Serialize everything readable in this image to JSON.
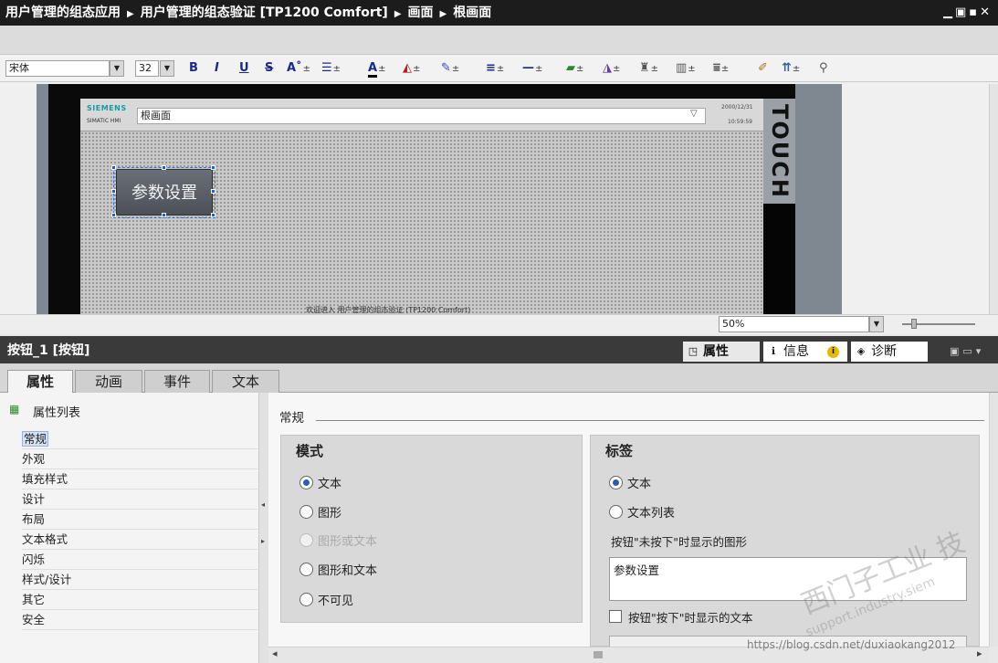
{
  "titlebar": {
    "crumbs": [
      "用户管理的组态应用",
      "用户管理的组态验证 [TP1200 Comfort]",
      "画面",
      "根画面"
    ],
    "separator": "▶",
    "controls": "▁▣▪✕"
  },
  "toolbar": {
    "font_name": "宋体",
    "font_size": "32",
    "bold": "B",
    "italic": "I",
    "underline": "U",
    "strike": "S",
    "super": "A˚",
    "sub_mark": "±"
  },
  "hmi": {
    "logo": "SIEMENS",
    "logo_sub": "SIMATIC HMI",
    "screen_name": "根画面",
    "chevron": "▽",
    "date": "2000/12/31",
    "time": "10:59:59",
    "touch": "TOUCH",
    "button_label": "参数设置",
    "footer": "欢迎进入  用户管理的组态验证  (TP1200 Comfort)"
  },
  "zoom": {
    "value": "50%"
  },
  "inspector": {
    "object_title": "按钮_1 [按钮]",
    "tabs": [
      {
        "label": "属性",
        "icon": "◳"
      },
      {
        "label": "信息",
        "icon": "ℹ"
      },
      {
        "label": "诊断",
        "icon": "◈"
      }
    ],
    "info_badge": "i",
    "subtabs": [
      "属性",
      "动画",
      "事件",
      "文本"
    ],
    "property_list_title": "属性列表",
    "property_list": [
      "常规",
      "外观",
      "填充样式",
      "设计",
      "布局",
      "文本格式",
      "闪烁",
      "样式/设计",
      "其它",
      "安全"
    ],
    "section_title": "常规",
    "mode": {
      "title": "模式",
      "options": [
        {
          "label": "文本",
          "checked": true,
          "disabled": false
        },
        {
          "label": "图形",
          "checked": false,
          "disabled": false
        },
        {
          "label": "图形或文本",
          "checked": false,
          "disabled": true
        },
        {
          "label": "图形和文本",
          "checked": false,
          "disabled": false
        },
        {
          "label": "不可见",
          "checked": false,
          "disabled": false
        }
      ]
    },
    "label": {
      "title": "标签",
      "options": [
        {
          "label": "文本",
          "checked": true
        },
        {
          "label": "文本列表",
          "checked": false
        }
      ],
      "unpressed_caption": "按钮\"未按下\"时显示的图形",
      "unpressed_text": "参数设置",
      "pressed_caption": "按钮\"按下\"时显示的文本"
    }
  },
  "watermark": {
    "line1": "西门子工业  技",
    "line2": "support.industry.siem",
    "csdn": "https://blog.csdn.net/duxiaokang2012"
  }
}
